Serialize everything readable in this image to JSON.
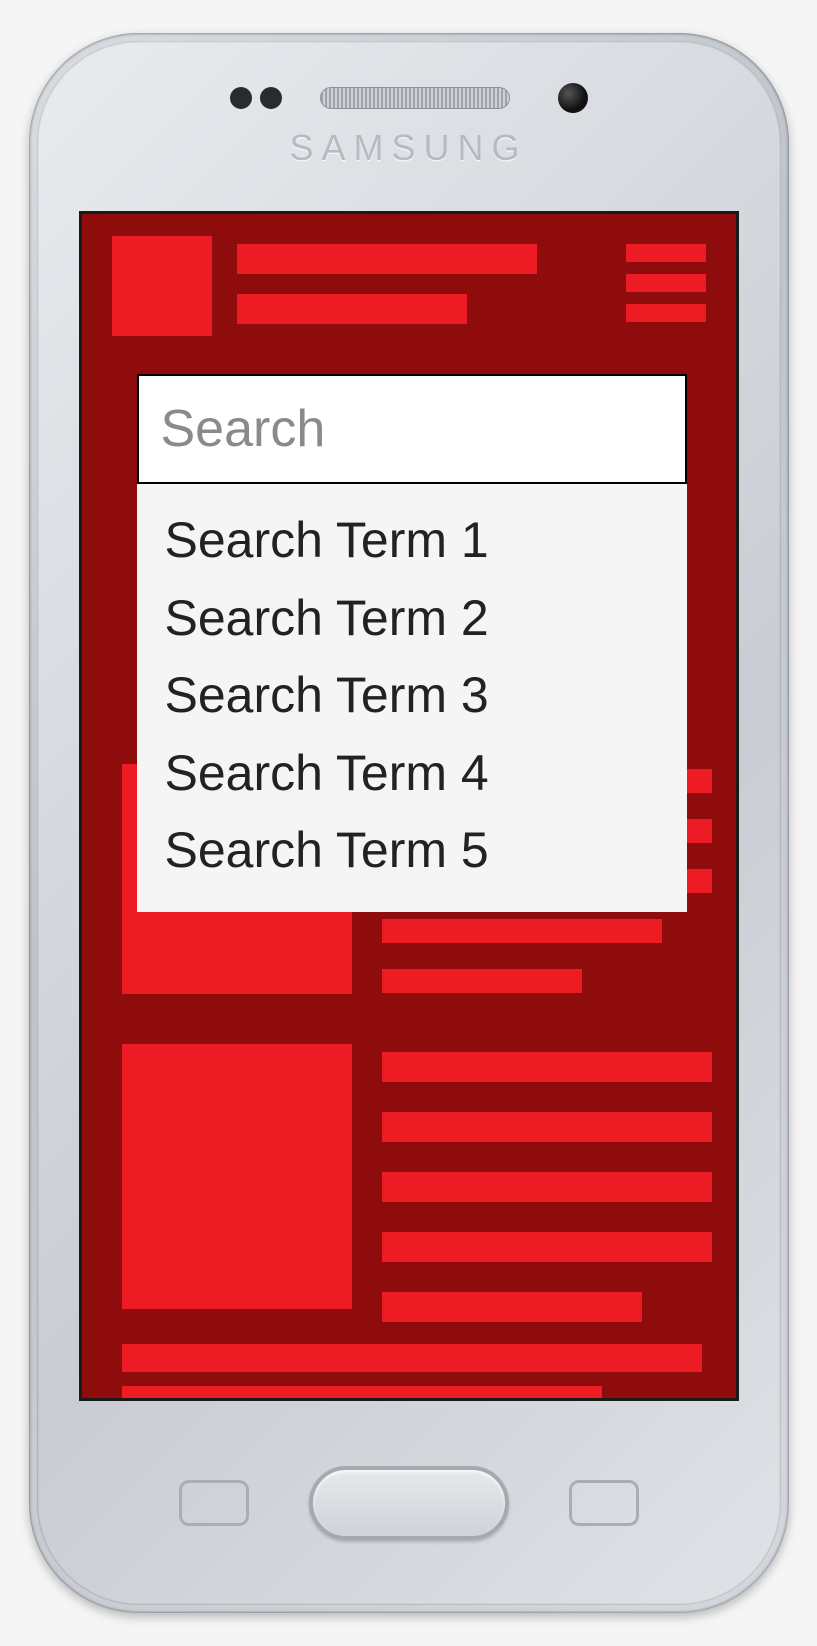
{
  "device": {
    "brand": "SAMSUNG"
  },
  "colors": {
    "screen_bg": "#8f0c0c",
    "accent": "#ed1b24"
  },
  "search": {
    "placeholder": "Search",
    "value": "",
    "suggestions": [
      "Search Term 1",
      "Search Term 2",
      "Search Term 3",
      "Search Term 4",
      "Search Term 5"
    ]
  }
}
